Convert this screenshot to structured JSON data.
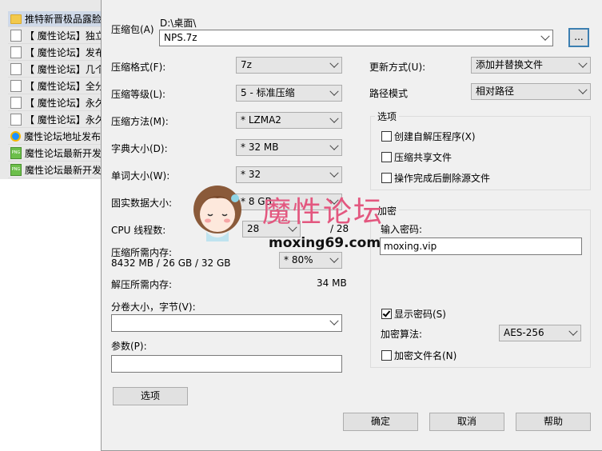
{
  "filelist": [
    {
      "icon": "folder-icon",
      "text": "推特新晋极品露脸"
    },
    {
      "icon": "document-icon",
      "text": "【 魔性论坛】独立"
    },
    {
      "icon": "document-icon",
      "text": "【 魔性论坛】发布"
    },
    {
      "icon": "document-icon",
      "text": "【 魔性论坛】几个"
    },
    {
      "icon": "document-icon",
      "text": "【 魔性论坛】全分"
    },
    {
      "icon": "document-icon",
      "text": "【 魔性论坛】永久"
    },
    {
      "icon": "document-icon",
      "text": "【 魔性论坛】永久"
    },
    {
      "icon": "ie-icon",
      "text": "魔性论坛地址发布"
    },
    {
      "icon": "png-icon",
      "text": "魔性论坛最新开发"
    },
    {
      "icon": "png-icon",
      "text": "魔性论坛最新开发"
    }
  ],
  "archive": {
    "label": "压缩包(A)",
    "path": "D:\\桌面\\",
    "filename": "NPS.7z",
    "browse": "..."
  },
  "left": {
    "format": {
      "label": "压缩格式(F):",
      "value": "7z"
    },
    "level": {
      "label": "压缩等级(L):",
      "value": "5 - 标准压缩"
    },
    "method": {
      "label": "压缩方法(M):",
      "value": "* LZMA2"
    },
    "dict": {
      "label": "字典大小(D):",
      "value": "* 32 MB"
    },
    "word": {
      "label": "单词大小(W):",
      "value": "* 32"
    },
    "solid": {
      "label": "固实数据大小:",
      "value": "* 8 GB"
    },
    "cpu": {
      "label": "CPU 线程数:",
      "value": "28",
      "max": "/ 28"
    },
    "memcomp": {
      "label": "压缩所需内存:",
      "detail": "8432 MB / 26 GB / 32 GB",
      "value": "* 80%"
    },
    "memdecomp": {
      "label": "解压所需内存:",
      "value": "34 MB"
    },
    "split": {
      "label": "分卷大小，字节(V):",
      "value": ""
    },
    "params": {
      "label": "参数(P):",
      "value": ""
    },
    "options_btn": "选项"
  },
  "right": {
    "update": {
      "label": "更新方式(U):",
      "value": "添加并替换文件"
    },
    "pathmode": {
      "label": "路径模式",
      "value": "相对路径"
    },
    "options": {
      "title": "选项",
      "sfx": "创建自解压程序(X)",
      "shared": "压缩共享文件",
      "delete": "操作完成后删除源文件"
    },
    "encryption": {
      "title": "加密",
      "pwd_label": "输入密码:",
      "pwd_value": "moxing.vip",
      "show_pwd": "显示密码(S)",
      "method_label": "加密算法:",
      "method_value": "AES-256",
      "encrypt_names": "加密文件名(N)"
    }
  },
  "buttons": {
    "ok": "确定",
    "cancel": "取消",
    "help": "帮助"
  },
  "watermark": {
    "title": "魔性论坛",
    "url": "moxing69.com"
  }
}
